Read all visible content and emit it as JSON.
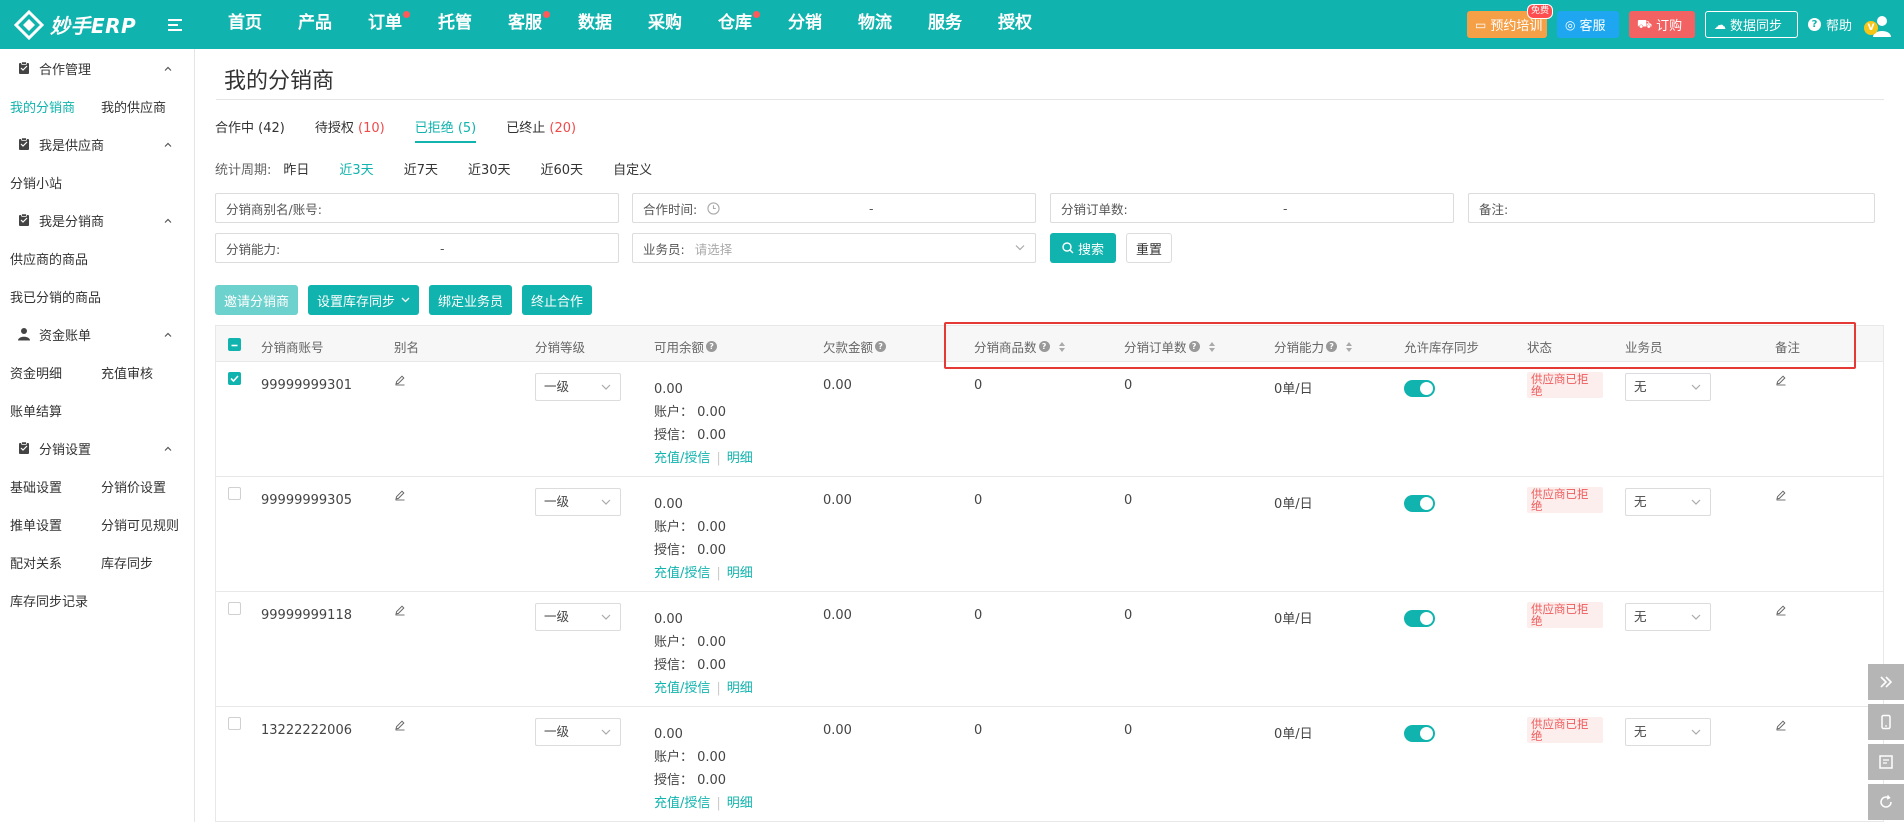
{
  "header": {
    "logo_text": "妙手ERP",
    "nav": [
      {
        "label": "首页",
        "dot": false
      },
      {
        "label": "产品",
        "dot": false
      },
      {
        "label": "订单",
        "dot": true
      },
      {
        "label": "托管",
        "dot": false
      },
      {
        "label": "客服",
        "dot": true
      },
      {
        "label": "数据",
        "dot": false
      },
      {
        "label": "采购",
        "dot": false
      },
      {
        "label": "仓库",
        "dot": true
      },
      {
        "label": "分销",
        "dot": false
      },
      {
        "label": "物流",
        "dot": false
      },
      {
        "label": "服务",
        "dot": false
      },
      {
        "label": "授权",
        "dot": false
      }
    ],
    "train_label": "预约培训",
    "train_badge": "免费",
    "service_label": "客服",
    "order_label": "订购",
    "sync_label": "数据同步",
    "help_label": "帮助",
    "avatar_badge": "V",
    "colors": {
      "primary": "#10b3ad",
      "train": "#f59f47",
      "service": "#1ea6f0",
      "order": "#f26262"
    }
  },
  "sidebar": {
    "groups": [
      {
        "title": "合作管理",
        "icon": "clipboard-icon",
        "rows": [
          [
            "我的分销商",
            "我的供应商"
          ]
        ]
      },
      {
        "title": "我是供应商",
        "icon": "clipboard-icon",
        "rows": [
          [
            "分销小站"
          ]
        ]
      },
      {
        "title": "我是分销商",
        "icon": "clipboard-icon",
        "rows": [
          [
            "供应商的商品"
          ],
          [
            "我已分销的商品"
          ]
        ]
      },
      {
        "title": "资金账单",
        "icon": "user-icon",
        "rows": [
          [
            "资金明细",
            "充值审核"
          ],
          [
            "账单结算"
          ]
        ]
      },
      {
        "title": "分销设置",
        "icon": "clipboard-icon",
        "rows": [
          [
            "基础设置",
            "分销价设置"
          ],
          [
            "推单设置",
            "分销可见规则"
          ],
          [
            "配对关系",
            "库存同步"
          ],
          [
            "库存同步记录"
          ]
        ]
      }
    ],
    "active": "我的分销商"
  },
  "main": {
    "title": "我的分销商",
    "tabs": [
      {
        "label": "合作中",
        "count": "(42)",
        "red": false,
        "active": false
      },
      {
        "label": "待授权",
        "count": "(10)",
        "red": true,
        "active": false
      },
      {
        "label": "已拒绝",
        "count": "(5)",
        "red": false,
        "active": true
      },
      {
        "label": "已终止",
        "count": "(20)",
        "red": true,
        "active": false
      }
    ],
    "period_label": "统计周期:",
    "periods": [
      "昨日",
      "近3天",
      "近7天",
      "近30天",
      "近60天",
      "自定义"
    ],
    "period_active": "近3天",
    "filters": {
      "alias": "分销商别名/账号:",
      "coop_time": "合作时间:",
      "order_count": "分销订单数:",
      "remark": "备注:",
      "capacity": "分销能力:",
      "salesperson": "业务员:",
      "salesperson_placeholder": "请选择",
      "dash": "-"
    },
    "search_label": "搜索",
    "reset_label": "重置",
    "actions": [
      "邀请分销商",
      "设置库存同步",
      "绑定业务员",
      "终止合作"
    ],
    "columns": {
      "account": "分销商账号",
      "alias": "别名",
      "level": "分销等级",
      "balance": "可用余额",
      "debt": "欠款金额",
      "goods": "分销商品数",
      "orders": "分销订单数",
      "capacity": "分销能力",
      "sync": "允许库存同步",
      "status": "状态",
      "salesperson": "业务员",
      "remark": "备注"
    },
    "rows": [
      {
        "account": "99999999301",
        "level": "一级",
        "balance": "0.00",
        "account_bal": "账户：  0.00",
        "credit": "授信：  0.00",
        "recharge": "充值/授信",
        "detail": "明细",
        "debt": "0.00",
        "goods": "0",
        "orders": "0",
        "capacity": "0单/日",
        "sync_on": true,
        "status": "供应商已拒绝",
        "salesperson": "无",
        "checked": true
      },
      {
        "account": "99999999305",
        "level": "一级",
        "balance": "0.00",
        "account_bal": "账户：  0.00",
        "credit": "授信：  0.00",
        "recharge": "充值/授信",
        "detail": "明细",
        "debt": "0.00",
        "goods": "0",
        "orders": "0",
        "capacity": "0单/日",
        "sync_on": true,
        "status": "供应商已拒绝",
        "salesperson": "无",
        "checked": false
      },
      {
        "account": "99999999118",
        "level": "一级",
        "balance": "0.00",
        "account_bal": "账户：  0.00",
        "credit": "授信：  0.00",
        "recharge": "充值/授信",
        "detail": "明细",
        "debt": "0.00",
        "goods": "0",
        "orders": "0",
        "capacity": "0单/日",
        "sync_on": true,
        "status": "供应商已拒绝",
        "salesperson": "无",
        "checked": false
      },
      {
        "account": "13222222006",
        "level": "一级",
        "balance": "0.00",
        "account_bal": "账户：  0.00",
        "credit": "授信：  0.00",
        "recharge": "充值/授信",
        "detail": "明细",
        "debt": "0.00",
        "goods": "0",
        "orders": "0",
        "capacity": "0单/日",
        "sync_on": true,
        "status": "供应商已拒绝",
        "salesperson": "无",
        "checked": false
      }
    ]
  },
  "float_tools": [
    "collapse-icon",
    "mobile-icon",
    "feedback-icon",
    "refresh-icon"
  ]
}
